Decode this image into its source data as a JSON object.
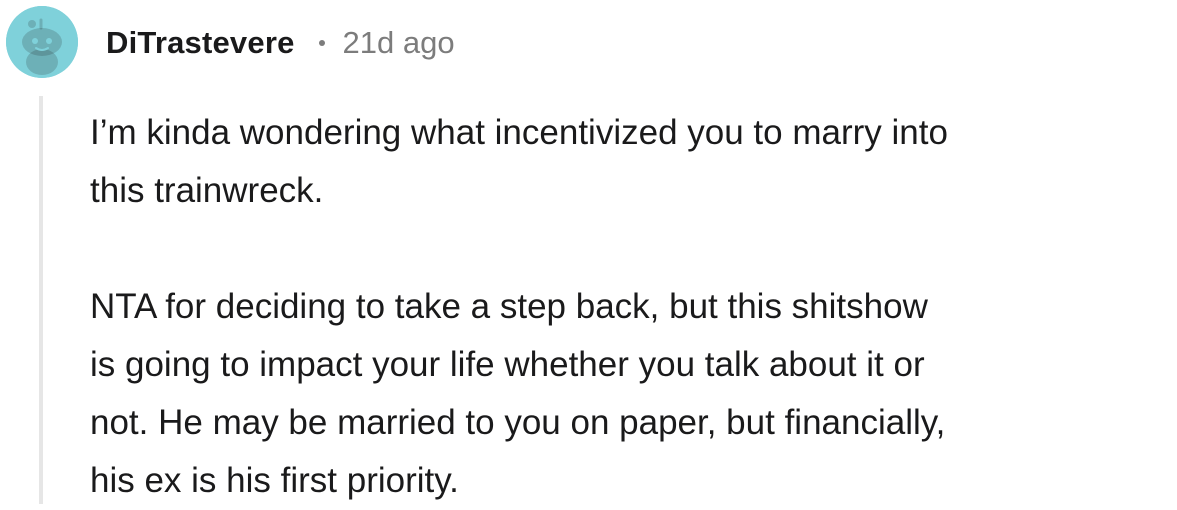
{
  "comment": {
    "username": "DiTrastevere",
    "timestamp": "21d ago",
    "avatar": {
      "icon": "reddit-snoo-avatar-icon",
      "background": "#7fd1da"
    },
    "paragraphs": [
      "I’m kinda wondering what incentivized you to marry into\nthis trainwreck.",
      "NTA for deciding to take a step back, but this shitshow\nis going to impact your life whether you talk about it or\nnot. He may be married to you on paper, but financially,\nhis ex is his first priority."
    ]
  }
}
